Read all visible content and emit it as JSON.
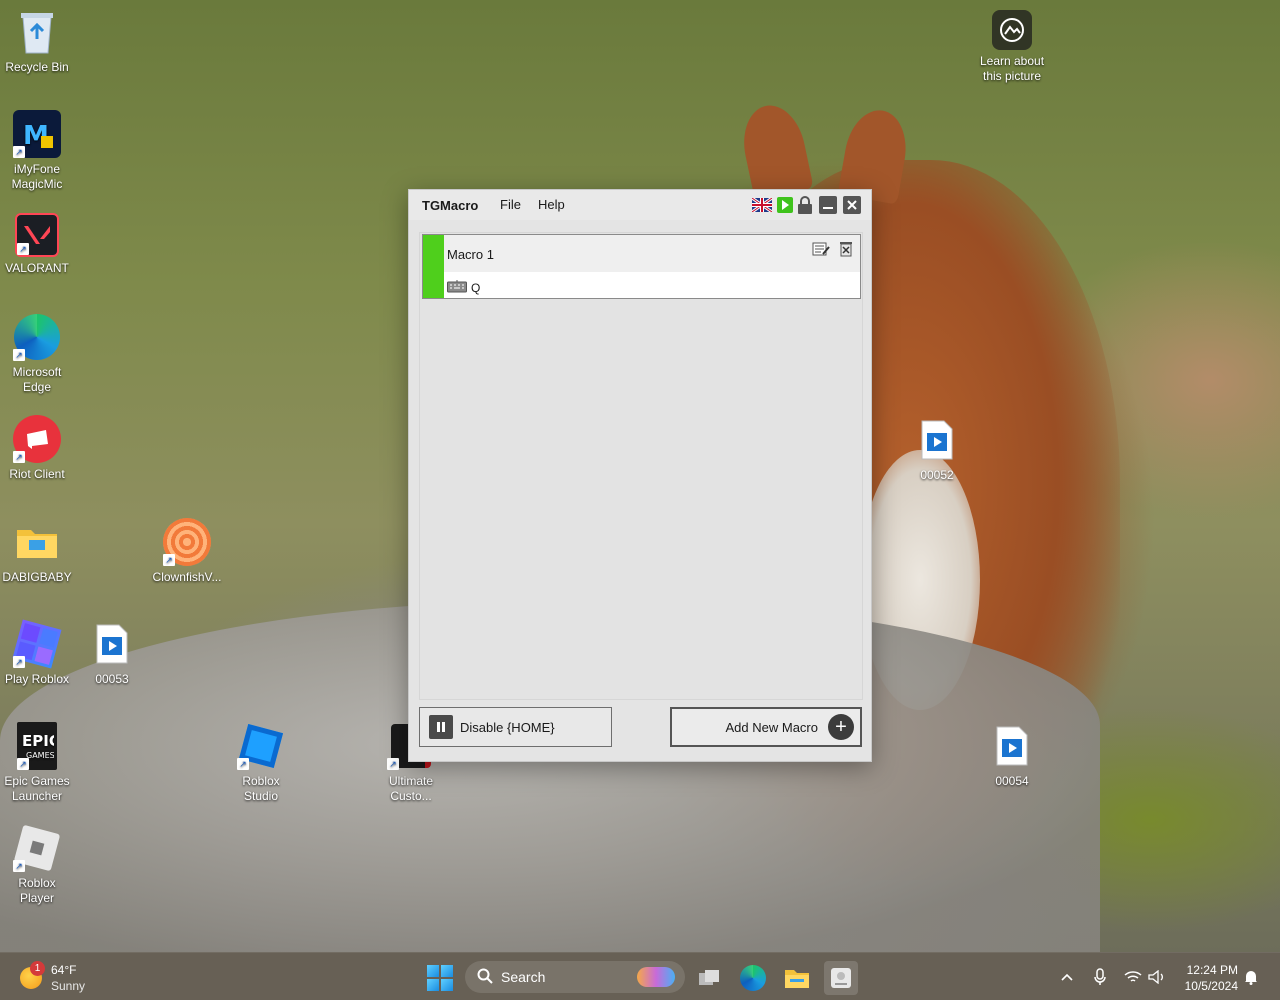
{
  "desktop": {
    "learn_picture": {
      "line1": "Learn about",
      "line2": "this picture",
      "icon": "camera-icon"
    },
    "icons": [
      {
        "line1": "Recycle Bin",
        "line2": "",
        "icon": "recycle-bin-icon"
      },
      {
        "line1": "iMyFone",
        "line2": "MagicMic",
        "icon": "magicmic-icon"
      },
      {
        "line1": "VALORANT",
        "line2": "",
        "icon": "valorant-icon"
      },
      {
        "line1": "Microsoft",
        "line2": "Edge",
        "icon": "edge-icon"
      },
      {
        "line1": "Riot Client",
        "line2": "",
        "icon": "riot-client-icon"
      },
      {
        "line1": "DABIGBABY",
        "line2": "",
        "icon": "folder-icon"
      },
      {
        "line1": "Play Roblox",
        "line2": "",
        "icon": "roblox-play-icon"
      },
      {
        "line1": "Epic Games",
        "line2": "Launcher",
        "icon": "epic-games-icon"
      },
      {
        "line1": "Roblox",
        "line2": "Player",
        "icon": "roblox-player-icon"
      },
      {
        "line1": "ClownfishV...",
        "line2": "",
        "icon": "clownfish-icon"
      },
      {
        "line1": "00053",
        "line2": "",
        "icon": "video-file-icon"
      },
      {
        "line1": "Roblox",
        "line2": "Studio",
        "icon": "roblox-studio-icon"
      },
      {
        "line1": "Ultimate",
        "line2": "Custo...",
        "icon": "ultimate-custom-icon"
      },
      {
        "line1": "00052",
        "line2": "",
        "icon": "video-file-icon"
      },
      {
        "line1": "00054",
        "line2": "",
        "icon": "video-file-icon"
      }
    ]
  },
  "window": {
    "title": "TGMacro",
    "menu": [
      "File",
      "Help"
    ],
    "toolbar_icons": [
      "uk-flag-icon",
      "play-icon",
      "lock-icon",
      "minimize-icon",
      "close-icon"
    ],
    "macros": [
      {
        "name": "Macro 1",
        "key": "Q",
        "status_color": "#4fcf1c"
      }
    ],
    "disable_label": "Disable {HOME}",
    "add_label": "Add New Macro"
  },
  "taskbar": {
    "weather_badge": "1",
    "temperature": "64°F",
    "condition": "Sunny",
    "search_placeholder": "Search",
    "time": "12:24 PM",
    "date": "10/5/2024"
  }
}
